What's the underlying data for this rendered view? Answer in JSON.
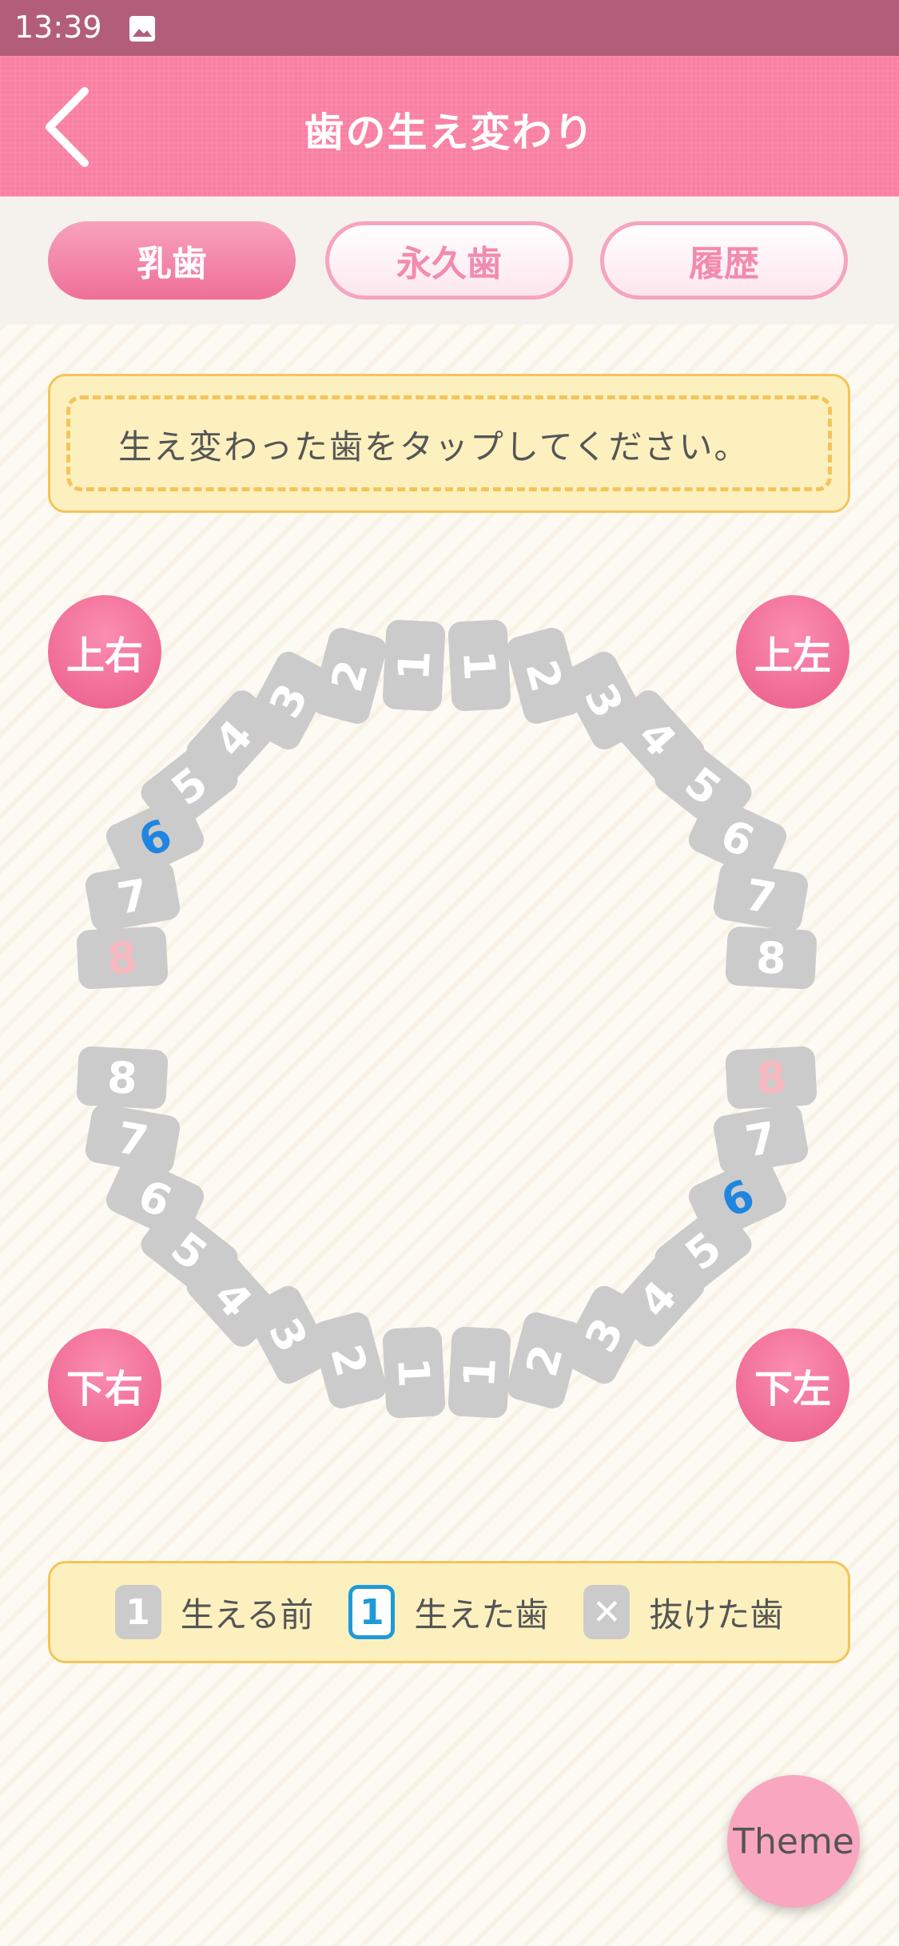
{
  "status_bar": {
    "time": "13:39",
    "icon": "image-icon"
  },
  "header": {
    "title": "歯の生え変わり",
    "back_icon": "chevron-left-icon"
  },
  "tabs": [
    {
      "label": "乳歯",
      "active": true
    },
    {
      "label": "永久歯",
      "active": false
    },
    {
      "label": "履歴",
      "active": false
    }
  ],
  "instruction": "生え変わった歯をタップしてください。",
  "quadrants": {
    "upper_right": "上右",
    "upper_left": "上左",
    "lower_right": "下右",
    "lower_left": "下左"
  },
  "teeth": {
    "upper_right": [
      "8",
      "7",
      "6",
      "5",
      "4",
      "3",
      "2",
      "1"
    ],
    "upper_left": [
      "1",
      "2",
      "3",
      "4",
      "5",
      "6",
      "7",
      "8"
    ],
    "lower_left": [
      "8",
      "7",
      "6",
      "5",
      "4",
      "3",
      "2",
      "1"
    ],
    "lower_right": [
      "1",
      "2",
      "3",
      "4",
      "5",
      "6",
      "7",
      "8"
    ]
  },
  "legend": [
    {
      "chip": "1",
      "label": "生える前"
    },
    {
      "chip": "1",
      "label": "生えた歯"
    },
    {
      "chip": "✕",
      "label": "抜けた歯"
    }
  ],
  "theme_button": "Theme",
  "colors": {
    "header": "#f97fa2",
    "status_bar": "#b25e7a",
    "accent_pink": "#ef6f98",
    "tooth_gray": "#cbcbcb",
    "erupted_blue": "#1f86e0",
    "legend_bg": "#fdf0bf"
  }
}
